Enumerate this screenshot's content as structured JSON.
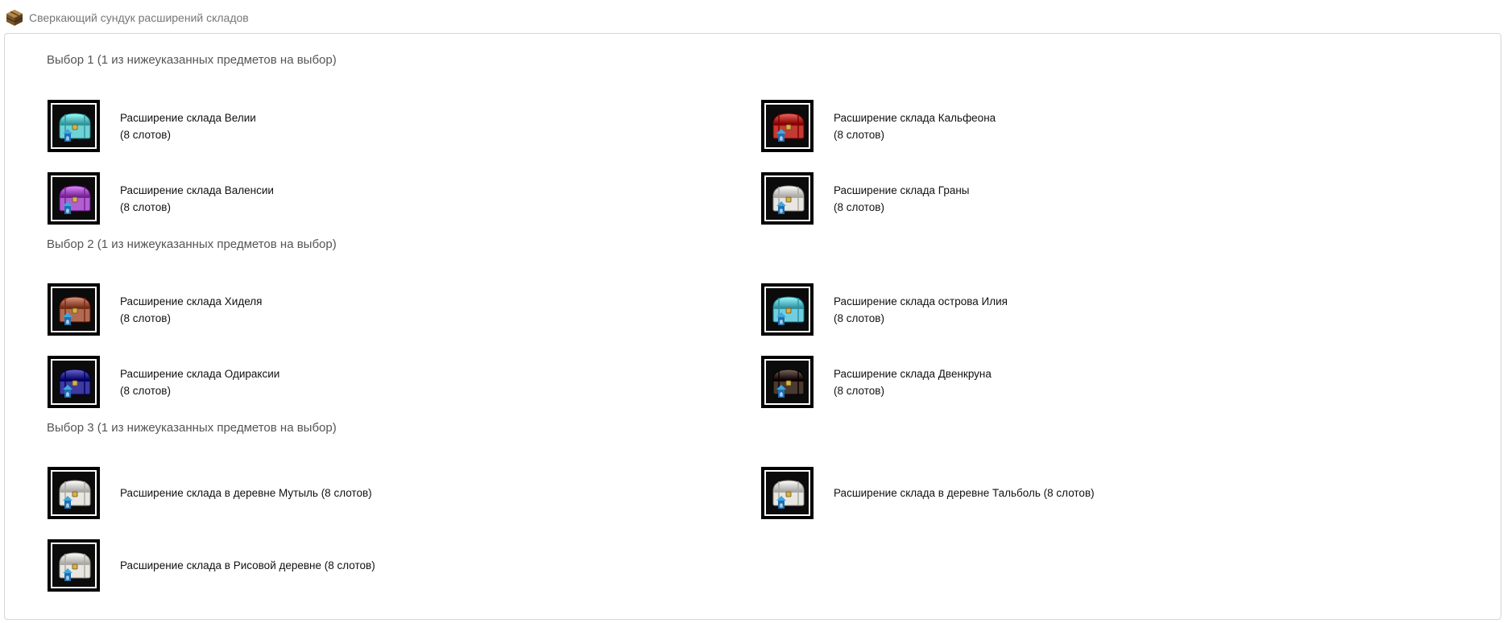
{
  "header": {
    "title": "Сверкающий сундук расширений складов",
    "icon": "wooden-chest-icon"
  },
  "sections": [
    {
      "title": "Выбор 1 (1 из нижеуказанных предметов на выбор)",
      "items": [
        {
          "name": "Расширение склада Велии",
          "note": "(8 слотов)",
          "color": "#6fd2d6",
          "badge": "8"
        },
        {
          "name": "Расширение склада Кальфеона",
          "note": "(8 слотов)",
          "color": "#c23b34",
          "badge": "8"
        },
        {
          "name": "Расширение склада Валенсии",
          "note": "(8 слотов)",
          "color": "#b25fd0",
          "badge": "8"
        },
        {
          "name": "Расширение склада Граны",
          "note": "(8 слотов)",
          "color": "#e8e6e1",
          "badge": "8"
        }
      ]
    },
    {
      "title": "Выбор 2 (1 из нижеуказанных предметов на выбор)",
      "items": [
        {
          "name": "Расширение склада Хиделя",
          "note": "(8 слотов)",
          "color": "#b26a52",
          "badge": "8"
        },
        {
          "name": "Расширение склада острова Илия",
          "note": "(8 слотов)",
          "color": "#6fcfe0",
          "badge": "8"
        },
        {
          "name": "Расширение склада Одираксии",
          "note": "(8 слотов)",
          "color": "#3e3aa0",
          "badge": "8"
        },
        {
          "name": "Расширение склада Двенкруна",
          "note": "(8 слотов)",
          "color": "#4a3a30",
          "badge": "8"
        }
      ]
    },
    {
      "title": "Выбор 3 (1 из нижеуказанных предметов на выбор)",
      "items": [
        {
          "name": "Расширение склада в деревне Мутыль (8 слотов)",
          "note": "",
          "color": "#e8e6e1",
          "badge": "8"
        },
        {
          "name": "Расширение склада в деревне Тальболь (8 слотов)",
          "note": "",
          "color": "#e8e6e1",
          "badge": "8"
        },
        {
          "name": "Расширение склада в Рисовой деревне (8 слотов)",
          "note": "",
          "color": "#e8e6e1",
          "badge": "8"
        }
      ]
    }
  ]
}
